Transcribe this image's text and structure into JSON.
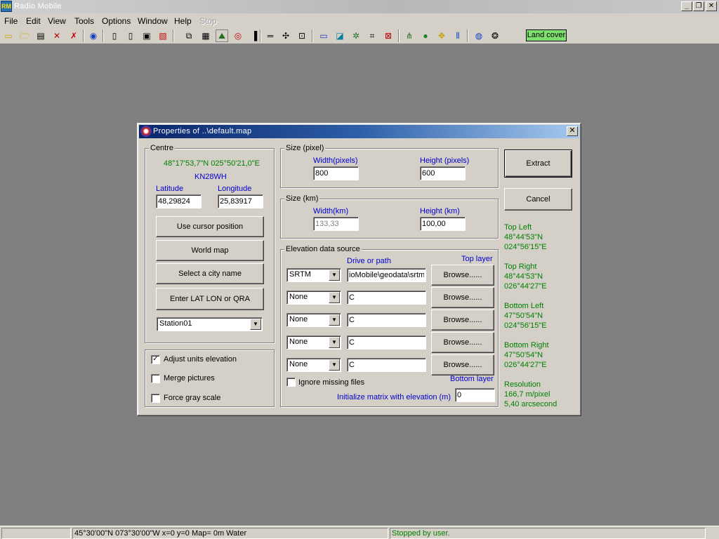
{
  "app": {
    "title": "Radio Mobile",
    "minimize": "_",
    "restore": "❐",
    "close": "✕"
  },
  "menu": [
    "File",
    "Edit",
    "View",
    "Tools",
    "Options",
    "Window",
    "Help",
    "Stop"
  ],
  "toolbar": {
    "land_cover": "Land cover"
  },
  "dialog": {
    "title": "Properties of ..\\default.map",
    "close": "✕",
    "centre": {
      "group": "Centre",
      "coords": "48°17'53,7\"N 025°50'21,0\"E",
      "qra": "KN28WH",
      "latitude_label": "Latitude",
      "longitude_label": "Longitude",
      "latitude": "48,29824",
      "longitude": "25,83917",
      "btn_cursor": "Use cursor position",
      "btn_world": "World map",
      "btn_city": "Select a city name",
      "btn_latlon": "Enter LAT LON or QRA",
      "station": "Station01"
    },
    "options": {
      "adjust": "Adjust units elevation",
      "adjust_checked": true,
      "merge": "Merge pictures",
      "gray": "Force gray scale"
    },
    "size_pixel": {
      "group": "Size (pixel)",
      "width_label": "Width(pixels)",
      "height_label": "Height (pixels)",
      "width": "800",
      "height": "600"
    },
    "size_km": {
      "group": "Size (km)",
      "width_label": "Width(km)",
      "height_label": "Height (km)",
      "width": "133,33",
      "height": "100,00"
    },
    "elevation": {
      "group": "Elevation data source",
      "drive_label": "Drive or path",
      "top_layer": "Top layer",
      "bottom_layer": "Bottom layer",
      "browse": "Browse......",
      "rows": [
        {
          "source": "SRTM",
          "path": "ioMobile\\geodata\\srtm"
        },
        {
          "source": "None",
          "path": "C"
        },
        {
          "source": "None",
          "path": "C"
        },
        {
          "source": "None",
          "path": "C"
        },
        {
          "source": "None",
          "path": "C"
        }
      ],
      "ignore_missing": "Ignore missing files",
      "init_label": "Initialize matrix with elevation (m)",
      "init_value": "0"
    },
    "extract": "Extract",
    "cancel": "Cancel",
    "corners": {
      "tl_label": "Top Left",
      "tl_lat": "48°44'53\"N",
      "tl_lon": "024°56'15\"E",
      "tr_label": "Top Right",
      "tr_lat": "48°44'53\"N",
      "tr_lon": "026°44'27\"E",
      "bl_label": "Bottom Left",
      "bl_lat": "47°50'54\"N",
      "bl_lon": "024°56'15\"E",
      "br_label": "Bottom Right",
      "br_lat": "47°50'54\"N",
      "br_lon": "026°44'27\"E",
      "res_label": "Resolution",
      "res_m": "166,7 m/pixel",
      "res_arc": "5,40 arcsecond"
    }
  },
  "status": {
    "position": "45°30'00\"N  073°30'00\"W   x=0 y=0 Map= 0m Water",
    "message": "Stopped by user."
  },
  "colors": {
    "workspace": "#808080",
    "face": "#d4d0c8",
    "label_blue": "#0000d0",
    "label_green": "#008000",
    "land_cover": "#7fe06f"
  }
}
